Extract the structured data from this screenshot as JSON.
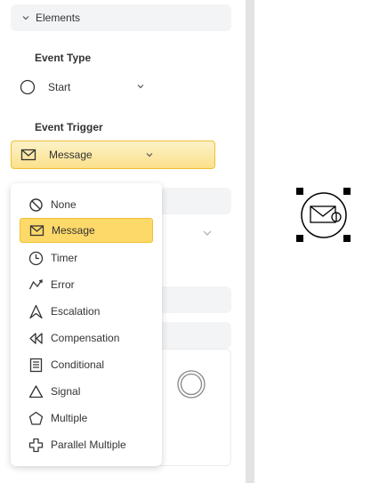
{
  "panel": {
    "section_title": "Elements",
    "event_type": {
      "label": "Event Type",
      "value": "Start"
    },
    "event_trigger": {
      "label": "Event Trigger",
      "value": "Message"
    }
  },
  "trigger_menu": {
    "selected": "Message",
    "items": [
      {
        "label": "None",
        "icon": "none-icon"
      },
      {
        "label": "Message",
        "icon": "message-icon"
      },
      {
        "label": "Timer",
        "icon": "timer-icon"
      },
      {
        "label": "Error",
        "icon": "error-icon"
      },
      {
        "label": "Escalation",
        "icon": "escalation-icon"
      },
      {
        "label": "Compensation",
        "icon": "compensation-icon"
      },
      {
        "label": "Conditional",
        "icon": "conditional-icon"
      },
      {
        "label": "Signal",
        "icon": "signal-icon"
      },
      {
        "label": "Multiple",
        "icon": "multiple-icon"
      },
      {
        "label": "Parallel Multiple",
        "icon": "parallel-multiple-icon"
      }
    ]
  },
  "colors": {
    "selected_bg": "#fdd96a",
    "selected_border": "#f0c030",
    "panel_bg": "#f3f4f6",
    "divider": "#e3e3e3"
  }
}
